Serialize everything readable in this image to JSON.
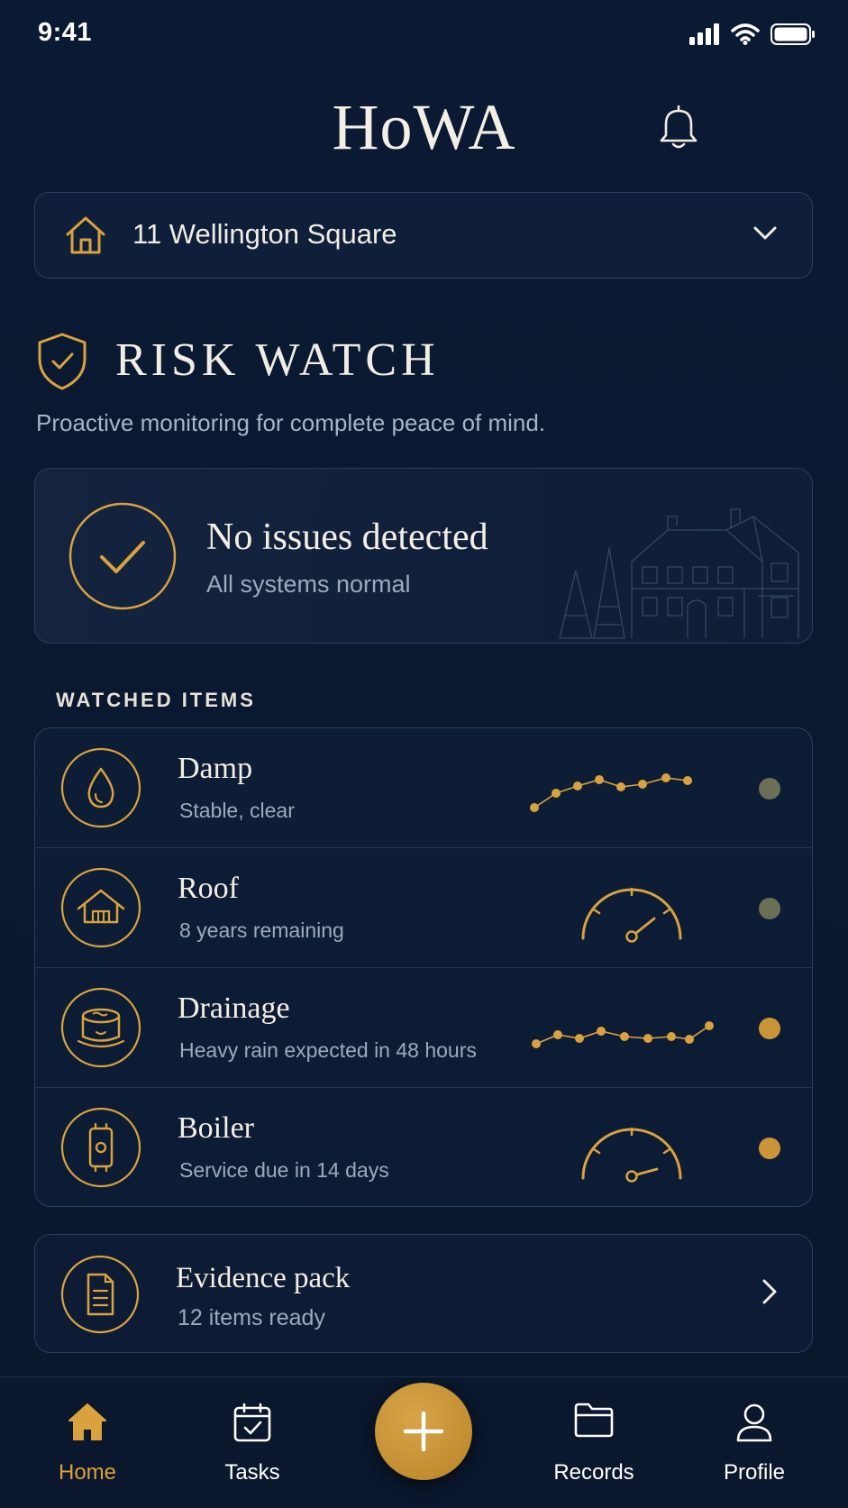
{
  "status_bar": {
    "time": "9:41"
  },
  "header": {
    "app_title": "HoWA"
  },
  "property": {
    "address": "11 Wellington Square"
  },
  "risk_watch": {
    "title": "RISK WATCH",
    "subtitle": "Proactive monitoring for complete peace of mind."
  },
  "status_card": {
    "title": "No issues detected",
    "subtitle": "All systems normal"
  },
  "watched": {
    "section_label": "WATCHED ITEMS",
    "items": [
      {
        "name": "Damp",
        "description": "Stable, clear",
        "indicator": "sparkline",
        "status_color": "#6b6f56",
        "icon": "water-drop-icon"
      },
      {
        "name": "Roof",
        "description": "8 years remaining",
        "indicator": "gauge",
        "status_color": "#6b6f56",
        "icon": "house-roof-icon"
      },
      {
        "name": "Drainage",
        "description": "Heavy rain expected in 48 hours",
        "indicator": "sparkline",
        "status_color": "#c99538",
        "icon": "drain-icon"
      },
      {
        "name": "Boiler",
        "description": "Service due in 14 days",
        "indicator": "gauge",
        "status_color": "#c99538",
        "icon": "boiler-icon"
      }
    ]
  },
  "evidence": {
    "title": "Evidence pack",
    "subtitle": "12 items ready"
  },
  "tabs": [
    {
      "label": "Home",
      "icon": "home-icon",
      "active": true
    },
    {
      "label": "Tasks",
      "icon": "tasks-icon",
      "active": false
    },
    {
      "label": "Records",
      "icon": "folder-icon",
      "active": false
    },
    {
      "label": "Profile",
      "icon": "profile-icon",
      "active": false
    }
  ],
  "colors": {
    "background": "#0b1a33",
    "accent_gold": "#d9a23e",
    "muted_text": "#9ea9bc",
    "border": "#2c3e5c"
  }
}
